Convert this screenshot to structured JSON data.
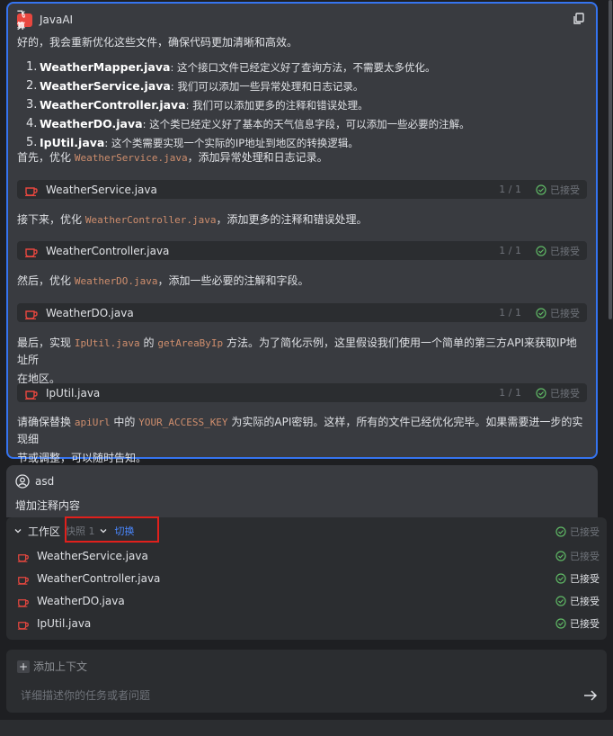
{
  "assistant": {
    "logo_text": "飞算",
    "name": "JavaAI",
    "intro": "好的，我会重新优化这些文件，确保代码更加清晰和高效。",
    "items": [
      {
        "num": "1.",
        "file": "WeatherMapper.java",
        "desc": ": 这个接口文件已经定义好了查询方法，不需要太多优化。"
      },
      {
        "num": "2.",
        "file": "WeatherService.java",
        "desc": ": 我们可以添加一些异常处理和日志记录。"
      },
      {
        "num": "3.",
        "file": "WeatherController.java",
        "desc": ": 我们可以添加更多的注释和错误处理。"
      },
      {
        "num": "4.",
        "file": "WeatherDO.java",
        "desc": ": 这个类已经定义好了基本的天气信息字段，可以添加一些必要的注解。"
      },
      {
        "num": "5.",
        "file": "IpUtil.java",
        "desc": ": 这个类需要实现一个实际的IP地址到地区的转换逻辑。"
      }
    ],
    "p1_a": "首先，优化 ",
    "p1_code": "WeatherService.java",
    "p1_b": "，添加异常处理和日志记录。",
    "p2_a": "接下来，优化 ",
    "p2_code": "WeatherController.java",
    "p2_b": "，添加更多的注释和错误处理。",
    "p3_a": "然后，优化 ",
    "p3_code": "WeatherDO.java",
    "p3_b": "，添加一些必要的注解和字段。",
    "p4_a": "最后，实现 ",
    "p4_code1": "IpUtil.java",
    "p4_b": " 的 ",
    "p4_code2": "getAreaByIp",
    "p4_c": " 方法。为了简化示例，这里假设我们使用一个简单的第三方API来获取IP地址所",
    "p4_d": "在地区。",
    "p5_a": "请确保替换 ",
    "p5_code1": "apiUrl",
    "p5_b": " 中的 ",
    "p5_code2": "YOUR_ACCESS_KEY",
    "p5_c": " 为实际的API密钥。这样，所有的文件已经优化完毕。如果需要进一步的实现细",
    "p5_d": "节或调整，可以随时告知。",
    "files": [
      {
        "name": "WeatherService.java",
        "count": "1 / 1",
        "status": "已接受"
      },
      {
        "name": "WeatherController.java",
        "count": "1 / 1",
        "status": "已接受"
      },
      {
        "name": "WeatherDO.java",
        "count": "1 / 1",
        "status": "已接受"
      },
      {
        "name": "IpUtil.java",
        "count": "1 / 1",
        "status": "已接受"
      }
    ]
  },
  "user": {
    "name": "asd",
    "message": "增加注释内容"
  },
  "workspace": {
    "title": "工作区",
    "snapshot": "快照 1",
    "switch": "切换",
    "status": "已接受",
    "files": [
      {
        "name": "WeatherService.java",
        "status": "已接受",
        "dim": true
      },
      {
        "name": "WeatherController.java",
        "status": "已接受",
        "dim": false
      },
      {
        "name": "WeatherDO.java",
        "status": "已接受",
        "dim": false
      },
      {
        "name": "IpUtil.java",
        "status": "已接受",
        "dim": false
      }
    ]
  },
  "input": {
    "add_context": "添加上下文",
    "placeholder": "详细描述你的任务或者问题"
  },
  "colors": {
    "accent": "#3574f0",
    "java_icon": "#e8473f",
    "code": "#cf8e6d",
    "accepted_green": "#5fb865",
    "highlight_red": "#e0201c",
    "link_blue": "#4a88ff"
  }
}
